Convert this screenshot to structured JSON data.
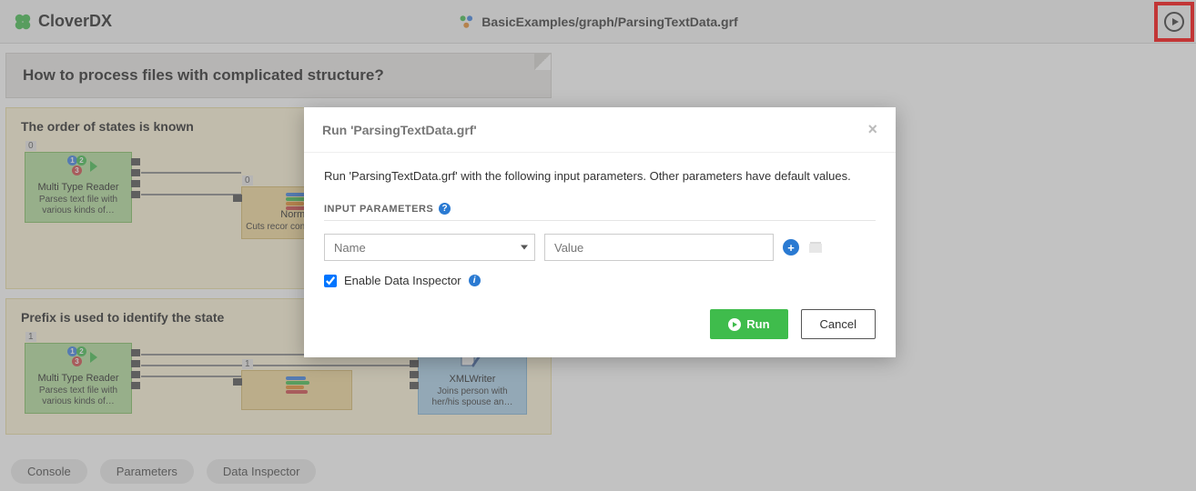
{
  "app": {
    "name": "CloverDX"
  },
  "breadcrumb": {
    "path": "BasicExamples/graph/ParsingTextData.grf"
  },
  "note": {
    "title": "How to process files with complicated structure?"
  },
  "section1": {
    "title": "The order of states is known",
    "reader": {
      "idx": "0",
      "name": "Multi Type Reader",
      "desc": "Parses text file with various kinds of…"
    },
    "normalizer": {
      "idx": "0",
      "name": "Normal",
      "desc": "Cuts recor contains all …"
    }
  },
  "section2": {
    "title": "Prefix is used to identify the state",
    "reader": {
      "idx": "1",
      "name": "Multi Type Reader",
      "desc": "Parses text file with various kinds of…"
    },
    "normalizer": {
      "idx": "1"
    },
    "xmlwriter": {
      "name": "XMLWriter",
      "desc": "Joins person with her/his spouse an…"
    }
  },
  "tabs": {
    "console": "Console",
    "parameters": "Parameters",
    "inspector": "Data Inspector"
  },
  "modal": {
    "title": "Run 'ParsingTextData.grf'",
    "message": "Run 'ParsingTextData.grf' with the following input parameters. Other parameters have default values.",
    "section_label": "INPUT PARAMETERS",
    "name_placeholder": "Name",
    "value_placeholder": "Value",
    "enable_inspector_label": "Enable Data Inspector",
    "enable_inspector_checked": true,
    "run_label": "Run",
    "cancel_label": "Cancel"
  }
}
